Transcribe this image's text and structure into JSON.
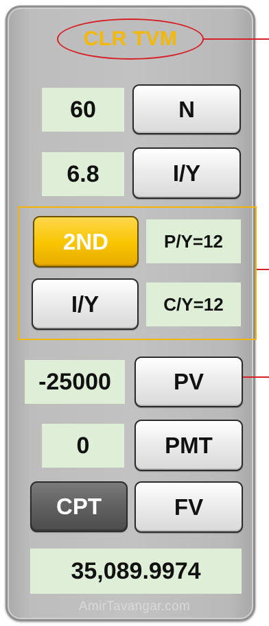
{
  "header": {
    "title": "CLR TVM"
  },
  "rows": {
    "n": {
      "value": "60",
      "key": "N"
    },
    "iy": {
      "value": "6.8",
      "key": "I/Y"
    },
    "pv": {
      "value": "-25000",
      "key": "PV"
    },
    "pmt": {
      "value": "0",
      "key": "PMT"
    },
    "fv": {
      "left_key": "CPT",
      "key": "FV"
    }
  },
  "settings": {
    "second_key": "2ND",
    "py_label": "P/Y=12",
    "iy_key": "I/Y",
    "cy_label": "C/Y=12"
  },
  "result": "35,089.9974",
  "watermark": "AmirTavangar.com",
  "colors": {
    "accent_yellow": "#F5B800",
    "annotation_red": "#D71F26",
    "value_bg": "#DFEED6",
    "panel_gray": "#BDBDBD",
    "dark_key": "#5E5E5E"
  }
}
